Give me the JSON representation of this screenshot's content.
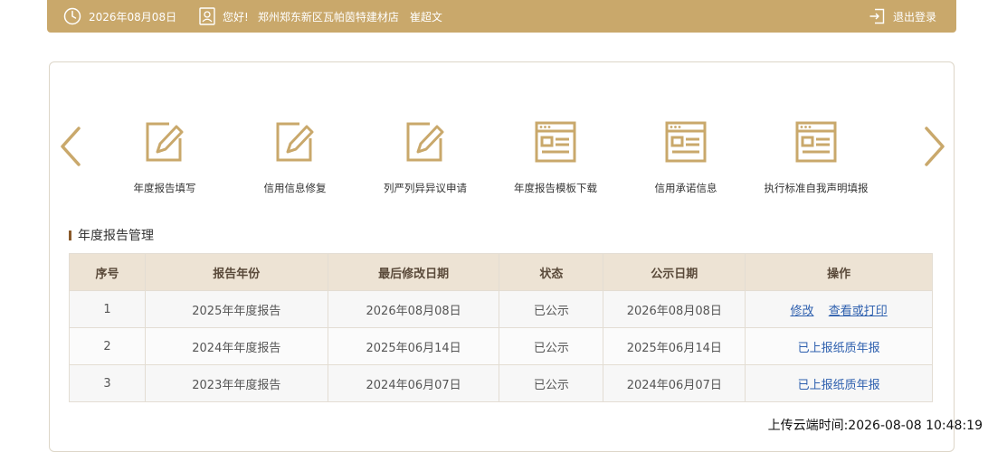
{
  "colors": {
    "brand": "#c9a86b",
    "accent_dark": "#8a5a2b",
    "header_row": "#ede3d4",
    "link": "#2d5fae"
  },
  "header": {
    "date": "2026年08月08日",
    "greeting": "您好!",
    "company": "郑州郑东新区瓦帕茵特建材店",
    "user": "崔超文",
    "logout": "退出登录",
    "icons": [
      "clock-icon",
      "user-card-icon",
      "logout-icon"
    ]
  },
  "carousel": {
    "items": [
      {
        "label": "年度报告填写",
        "icon": "edit-icon"
      },
      {
        "label": "信用信息修复",
        "icon": "edit-icon"
      },
      {
        "label": "列严列异异议申请",
        "icon": "edit-icon"
      },
      {
        "label": "年度报告模板下载",
        "icon": "form-window-icon"
      },
      {
        "label": "信用承诺信息",
        "icon": "form-window-icon"
      },
      {
        "label": "执行标准自我声明填报",
        "icon": "form-window-icon"
      }
    ]
  },
  "section": {
    "title": "年度报告管理"
  },
  "table": {
    "columns": [
      "序号",
      "报告年份",
      "最后修改日期",
      "状态",
      "公示日期",
      "操作"
    ],
    "rows": [
      {
        "index": "1",
        "year": "2025年年度报告",
        "modified": "2026年08月08日",
        "status": "已公示",
        "published": "2026年08月08日",
        "actions": [
          "修改",
          "查看或打印"
        ]
      },
      {
        "index": "2",
        "year": "2024年年度报告",
        "modified": "2025年06月14日",
        "status": "已公示",
        "published": "2025年06月14日",
        "actions": [
          "已上报纸质年报"
        ]
      },
      {
        "index": "3",
        "year": "2023年年度报告",
        "modified": "2024年06月07日",
        "status": "已公示",
        "published": "2024年06月07日",
        "actions": [
          "已上报纸质年报"
        ]
      }
    ]
  },
  "footer": {
    "upload_time": "上传云端时间:2026-08-08 10:48:19"
  }
}
